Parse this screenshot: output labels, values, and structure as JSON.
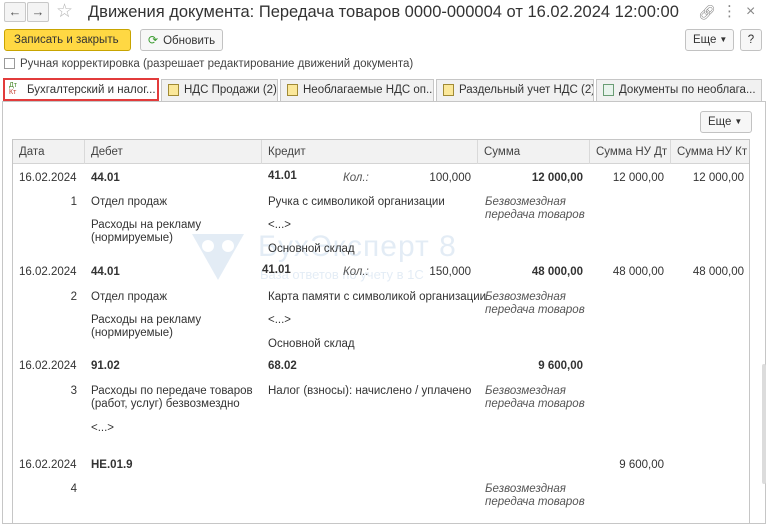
{
  "window": {
    "title": "Движения документа: Передача товаров 0000-000004 от 16.02.2024 12:00:00",
    "icons": {
      "back": "arrow-left-icon",
      "forward": "arrow-right-icon",
      "favorite": "star-icon",
      "link": "link-icon",
      "menu": "more-vertical-icon",
      "close": "close-icon"
    }
  },
  "toolbar": {
    "save_close": "Записать и закрыть",
    "refresh": "Обновить",
    "more": "Еще",
    "help": "?"
  },
  "manual_correction": {
    "label": "Ручная корректировка (разрешает редактирование движений документа)",
    "checked": false
  },
  "tabs": [
    {
      "label": "Бухгалтерский и налог...",
      "active": true
    },
    {
      "label": "НДС Продажи (2)",
      "active": false
    },
    {
      "label": "Необлагаемые НДС оп...",
      "active": false
    },
    {
      "label": "Раздельный учет НДС (2)",
      "active": false
    },
    {
      "label": "Документы по необлага...",
      "active": false
    }
  ],
  "grid": {
    "more": "Еще",
    "columns": [
      "Дата",
      "Дебет",
      "Кредит",
      "Сумма",
      "Сумма НУ Дт",
      "Сумма НУ Кт"
    ],
    "qty_label": "Кол.:",
    "rows": [
      {
        "date": "16.02.2024",
        "num": "1",
        "debit": "44.01",
        "debit_sub1": "Отдел продаж",
        "debit_sub2": "Расходы на рекламу (нормируемые)",
        "credit": "41.01",
        "qty": "100,000",
        "credit_sub1": "Ручка с символикой организации",
        "credit_sub2": "<...>",
        "credit_sub3": "Основной склад",
        "amount": "12 000,00",
        "content": "Безвозмездная передача товаров",
        "nu_dt": "12 000,00",
        "nu_kt": "12 000,00"
      },
      {
        "date": "16.02.2024",
        "num": "2",
        "debit": "44.01",
        "debit_sub1": "Отдел продаж",
        "debit_sub2": "Расходы на рекламу (нормируемые)",
        "credit": "41.01",
        "qty": "150,000",
        "credit_sub1": "Карта памяти с символикой организации",
        "credit_sub2": "<...>",
        "credit_sub3": "Основной склад",
        "amount": "48 000,00",
        "content": "Безвозмездная передача товаров",
        "nu_dt": "48 000,00",
        "nu_kt": "48 000,00"
      },
      {
        "date": "16.02.2024",
        "num": "3",
        "debit": "91.02",
        "debit_sub1": "Расходы по передаче товаров (работ, услуг) безвозмездно",
        "debit_sub2": "<...>",
        "credit": "68.02",
        "credit_sub1": "Налог (взносы): начислено / уплачено",
        "amount": "9 600,00",
        "content": "Безвозмездная передача товаров"
      },
      {
        "date": "16.02.2024",
        "num": "4",
        "debit": "НЕ.01.9",
        "content": "Безвозмездная передача товаров",
        "nu_dt": "9 600,00"
      }
    ]
  },
  "watermark": {
    "brand": "БухЭксперт",
    "number": "8",
    "tagline": "База ответов по учету в 1С"
  }
}
